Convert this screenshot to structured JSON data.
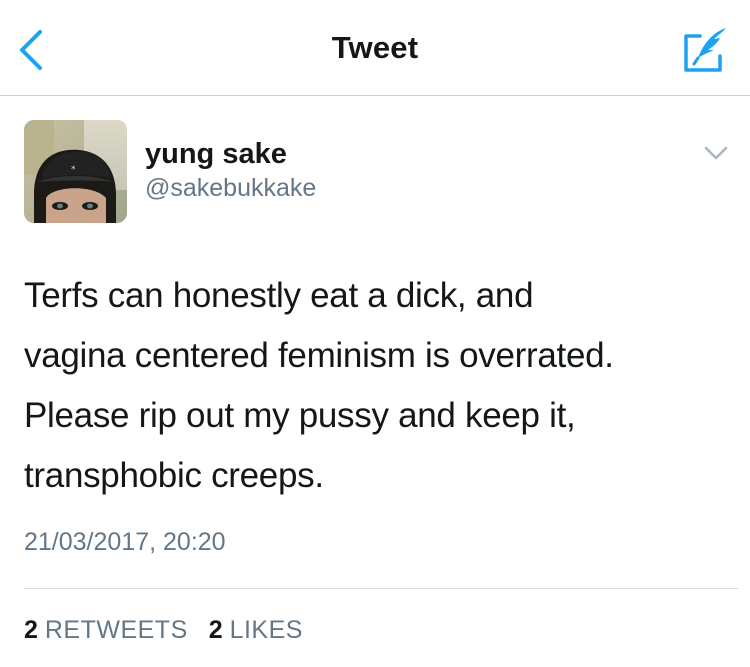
{
  "nav": {
    "title": "Tweet",
    "accent_color": "#1da1f2",
    "back_icon": "chevron-left-icon",
    "compose_icon": "compose-quill-icon"
  },
  "tweet": {
    "author": {
      "display_name": "yung sake",
      "handle": "@sakebukkake"
    },
    "text_lines": [
      "Terfs can honestly eat a dick, and",
      "vagina centered feminism is overrated.",
      "Please rip out my pussy and keep it,",
      "transphobic creeps."
    ],
    "timestamp": "21/03/2017, 20:20",
    "stats": {
      "retweets_count": "2",
      "retweets_label": "RETWEETS",
      "likes_count": "2",
      "likes_label": "LIKES"
    }
  }
}
